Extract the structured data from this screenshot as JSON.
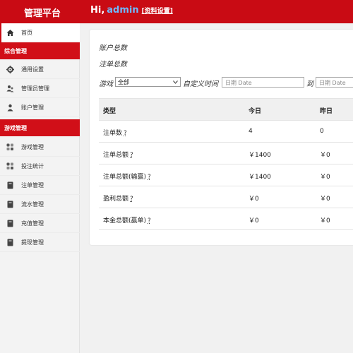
{
  "header": {
    "brand": "管理平台",
    "greeting": "Hi,",
    "username": "admin",
    "settings_link": "[资料设置]"
  },
  "sidebar": {
    "home": {
      "label": "首页",
      "icon": "home-icon"
    },
    "group_general": "综合管理",
    "general_items": [
      {
        "label": "通用设置",
        "icon": "gear-icon"
      },
      {
        "label": "管理员管理",
        "icon": "users-icon"
      },
      {
        "label": "账户管理",
        "icon": "user-icon"
      }
    ],
    "group_game": "游戏管理",
    "game_items": [
      {
        "label": "游戏管理",
        "icon": "grid-icon"
      },
      {
        "label": "投注统计",
        "icon": "grid-icon"
      },
      {
        "label": "注单管理",
        "icon": "book-icon"
      },
      {
        "label": "流水管理",
        "icon": "book-icon"
      },
      {
        "label": "充值管理",
        "icon": "book-icon"
      },
      {
        "label": "提现管理",
        "icon": "book-icon"
      }
    ]
  },
  "main": {
    "account_total": "账户总数",
    "order_total": "注单总数",
    "filter": {
      "game_label": "游戏",
      "game_selected": "全部",
      "custom_time_label": "自定义时间",
      "start_placeholder": "日期 Date",
      "to_label": "到",
      "end_placeholder": "日期 Date"
    },
    "table": {
      "headers": [
        "类型",
        "今日",
        "昨日"
      ],
      "help_marker": "?",
      "rows": [
        {
          "type": "注单数",
          "today": "4",
          "yesterday": "0"
        },
        {
          "type": "注单总额",
          "today": "￥1400",
          "yesterday": "￥0"
        },
        {
          "type": "注单总额(输赢)",
          "today": "￥1400",
          "yesterday": "￥0"
        },
        {
          "type": "盈利总额",
          "today": "￥0",
          "yesterday": "￥0"
        },
        {
          "type": "本金总额(赢单)",
          "today": "￥0",
          "yesterday": "￥0"
        }
      ]
    }
  },
  "colors": {
    "brand_red": "#c90b14",
    "username_blue": "#6fb8ff"
  }
}
